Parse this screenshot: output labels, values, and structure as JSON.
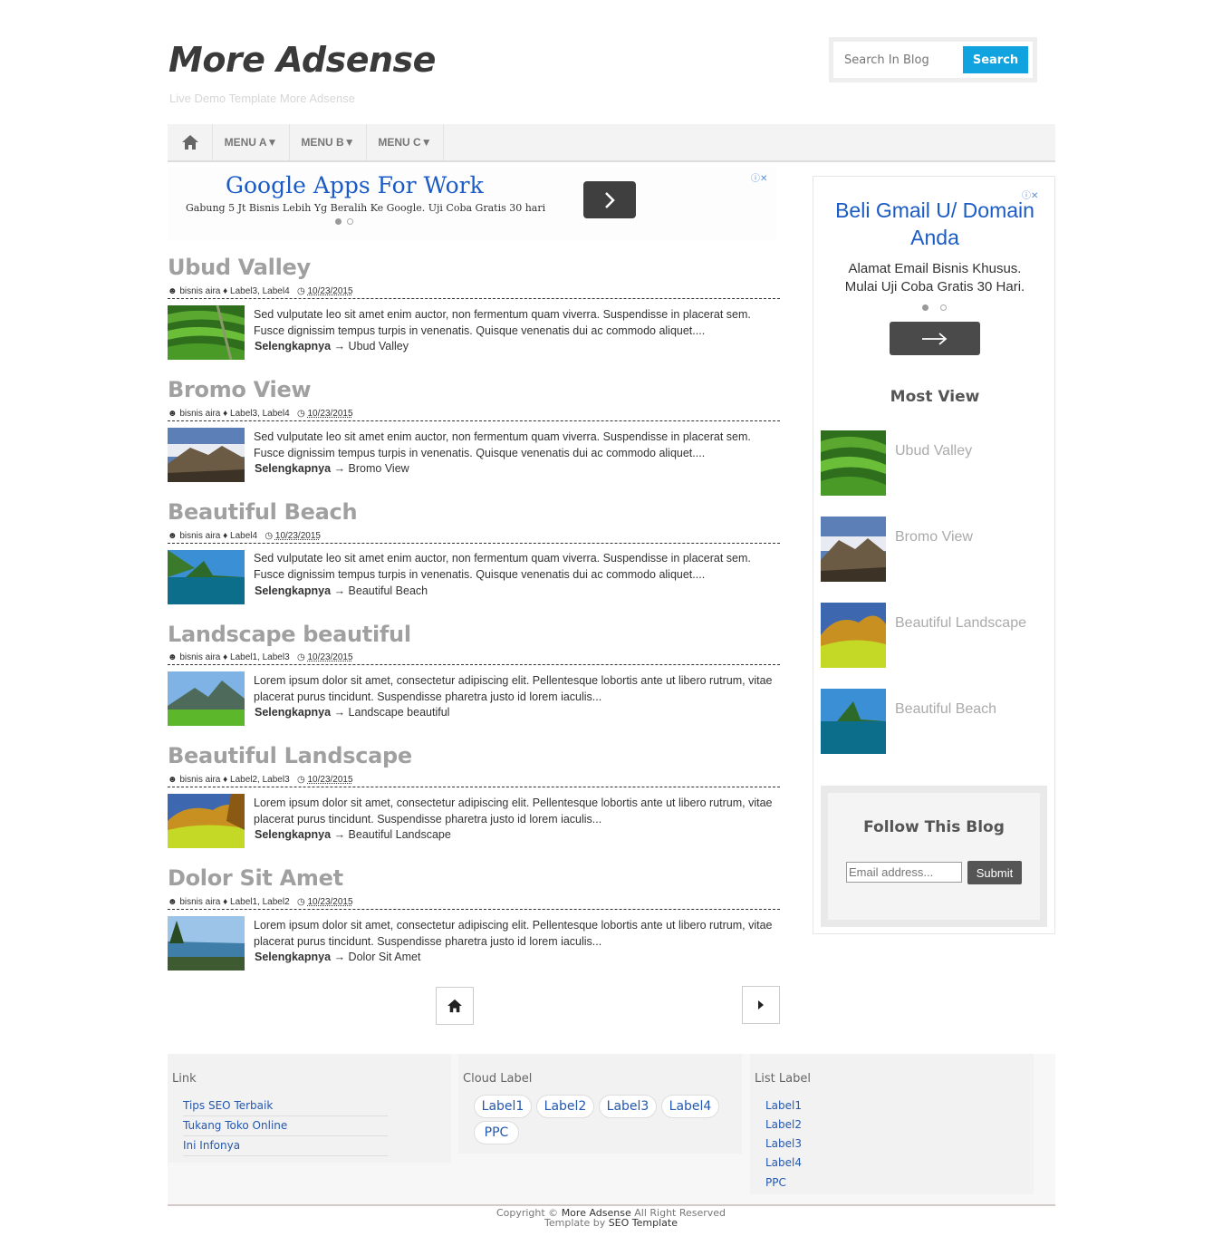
{
  "header": {
    "title": "More Adsense",
    "description": "Live Demo Template More Adsense",
    "search_placeholder": "Search In Blog",
    "search_button": "Search"
  },
  "nav": {
    "items": [
      {
        "label": "MENU A▼"
      },
      {
        "label": "MENU B▼"
      },
      {
        "label": "MENU C▼"
      }
    ]
  },
  "ad_top": {
    "title": "Google Apps For Work",
    "subtitle": "Gabung 5 Jt Bisnis Lebih Yg Beralih Ke Google. Uji Coba Gratis 30 hari"
  },
  "posts": [
    {
      "title": "Ubud Valley",
      "author": "bisnis aira",
      "labels": "Label3, Label4",
      "date": "10/23/2015",
      "snippet": "Sed vulputate leo sit amet enim auctor, non fermentum quam viverra. Suspendisse in placerat sem. Fusce dignissim tempus turpis in venenatis. Quisque venenatis dui ac commodo aliquet....",
      "more_label": "Selengkapnya",
      "more_link": "→ Ubud Valley"
    },
    {
      "title": "Bromo View",
      "author": "bisnis aira",
      "labels": "Label3, Label4",
      "date": "10/23/2015",
      "snippet": "Sed vulputate leo sit amet enim auctor, non fermentum quam viverra. Suspendisse in placerat sem. Fusce dignissim tempus turpis in venenatis. Quisque venenatis dui ac commodo aliquet....",
      "more_label": "Selengkapnya",
      "more_link": "→ Bromo View"
    },
    {
      "title": "Beautiful Beach",
      "author": "bisnis aira",
      "labels": "Label4",
      "date": "10/23/2015",
      "snippet": "Sed vulputate leo sit amet enim auctor, non fermentum quam viverra. Suspendisse in placerat sem. Fusce dignissim tempus turpis in venenatis. Quisque venenatis dui ac commodo aliquet....",
      "more_label": "Selengkapnya",
      "more_link": "→ Beautiful Beach"
    },
    {
      "title": "Landscape beautiful",
      "author": "bisnis aira",
      "labels": "Label1, Label3",
      "date": "10/23/2015",
      "snippet": "Lorem ipsum dolor sit amet, consectetur adipiscing elit. Pellentesque lobortis ante ut libero rutrum, vitae placerat purus tincidunt. Suspendisse pharetra justo id lorem iaculis...",
      "more_label": "Selengkapnya",
      "more_link": "→ Landscape beautiful"
    },
    {
      "title": "Beautiful Landscape",
      "author": "bisnis aira",
      "labels": "Label2, Label3",
      "date": "10/23/2015",
      "snippet": "Lorem ipsum dolor sit amet, consectetur adipiscing elit. Pellentesque lobortis ante ut libero rutrum, vitae placerat purus tincidunt. Suspendisse pharetra justo id lorem iaculis...",
      "more_label": "Selengkapnya",
      "more_link": "→ Beautiful Landscape"
    },
    {
      "title": "Dolor Sit Amet",
      "author": "bisnis aira",
      "labels": "Label1, Label2",
      "date": "10/23/2015",
      "snippet": "Lorem ipsum dolor sit amet, consectetur adipiscing elit. Pellentesque lobortis ante ut libero rutrum, vitae placerat purus tincidunt. Suspendisse pharetra justo id lorem iaculis...",
      "more_label": "Selengkapnya",
      "more_link": "→ Dolor Sit Amet"
    }
  ],
  "sidebar": {
    "ad_title": "Beli Gmail U/ Domain Anda",
    "ad_subtitle": "Alamat Email Bisnis Khusus. Mulai Uji Coba Gratis 30 Hari.",
    "most_view_title": "Most View",
    "popular": [
      {
        "title": "Ubud Valley"
      },
      {
        "title": "Bromo View"
      },
      {
        "title": "Beautiful Landscape"
      },
      {
        "title": "Beautiful Beach"
      }
    ],
    "follow_title": "Follow This Blog",
    "follow_placeholder": "Email address...",
    "follow_button": "Submit"
  },
  "footer": {
    "link_title": "Link",
    "links": [
      "Tips SEO Terbaik",
      "Tukang Toko Online",
      "Ini Infonya"
    ],
    "cloud_title": "Cloud Label",
    "cloud": [
      "Label1",
      "Label2",
      "Label3",
      "Label4",
      "PPC"
    ],
    "list_title": "List Label",
    "list": [
      "Label1",
      "Label2",
      "Label3",
      "Label4",
      "PPC"
    ],
    "copyright_prefix": "Copyright ©",
    "copyright_site": "More Adsense",
    "copyright_suffix": "All Right Reserved",
    "template_prefix": "Template by",
    "template_name": "SEO Template"
  },
  "colors": {
    "accent": "#10a3e0",
    "link": "#2358b0",
    "post_title": "#a0a0a0"
  }
}
